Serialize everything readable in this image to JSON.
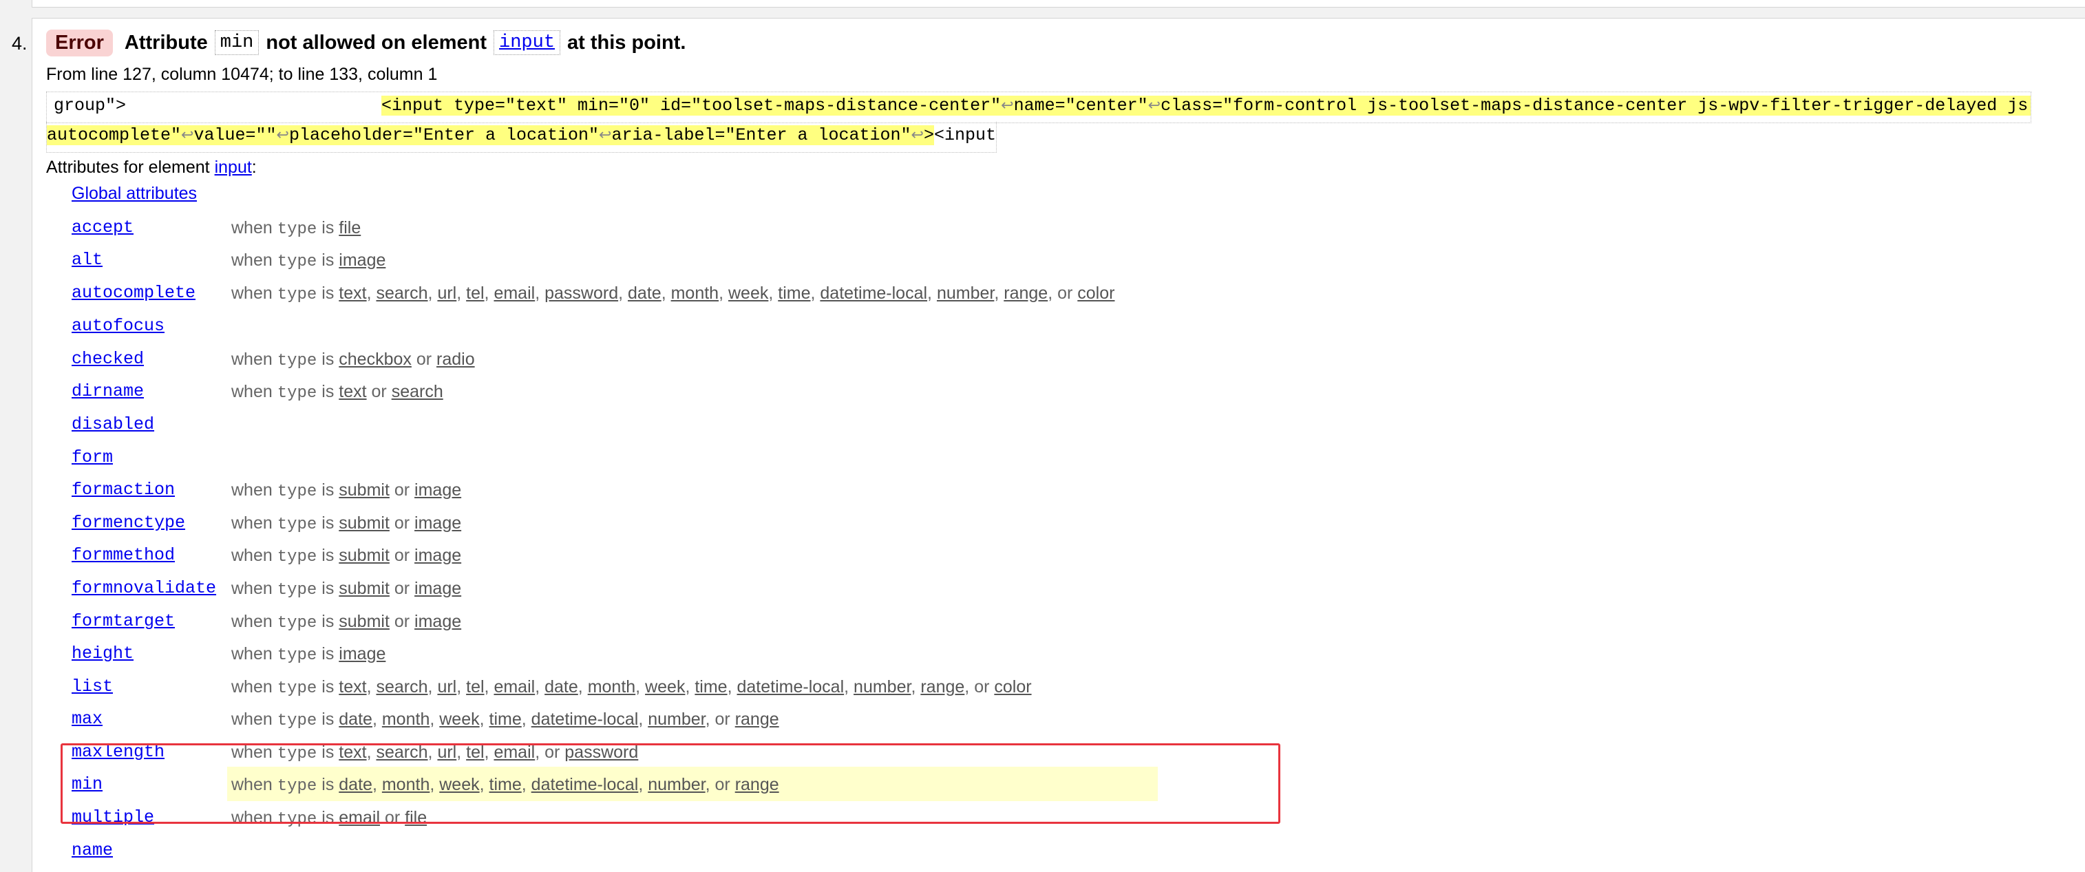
{
  "list_number": "4.",
  "error": {
    "badge": "Error",
    "word_attribute": "Attribute",
    "attribute": "min",
    "middle": "not allowed on element",
    "element": "input",
    "tail": "at this point."
  },
  "location": "From line 127, column 10474; to line 133, column 1",
  "extract": {
    "line1_plain": "group\">",
    "line1_hl": [
      "<input type=\"text\" min=\"0\" id=\"toolset-maps-distance-center\"",
      "name=\"center\"",
      "class=\"form-control js-toolset-maps-distance-center js-wpv-filter-trigger-delayed js-toolset-maps-address-"
    ],
    "line2_hl": [
      "autocomplete\"",
      "value=\"\"",
      "placeholder=\"Enter a location\"",
      "aria-label=\"Enter a location\"",
      ">"
    ],
    "line2_plain": "<input",
    "return_glyph": "↩"
  },
  "attributes_heading": {
    "prefix": "Attributes for element",
    "element": "input",
    "suffix": ":"
  },
  "global_attributes_label": "Global attributes",
  "when_type_is": "when",
  "type_kw": "type",
  "is_word": "is",
  "attributes": [
    {
      "name": "accept",
      "desc": "when type is",
      "values": [
        "file"
      ]
    },
    {
      "name": "alt",
      "desc": "when type is",
      "values": [
        "image"
      ]
    },
    {
      "name": "autocomplete",
      "desc": "when type is",
      "values": [
        "text",
        "search",
        "url",
        "tel",
        "email",
        "password",
        "date",
        "month",
        "week",
        "time",
        "datetime-local",
        "number",
        "range",
        "color"
      ]
    },
    {
      "name": "autofocus",
      "desc": "",
      "values": []
    },
    {
      "name": "checked",
      "desc": "when type is",
      "values": [
        "checkbox",
        "radio"
      ]
    },
    {
      "name": "dirname",
      "desc": "when type is",
      "values": [
        "text",
        "search"
      ]
    },
    {
      "name": "disabled",
      "desc": "",
      "values": []
    },
    {
      "name": "form",
      "desc": "",
      "values": []
    },
    {
      "name": "formaction",
      "desc": "when type is",
      "values": [
        "submit",
        "image"
      ]
    },
    {
      "name": "formenctype",
      "desc": "when type is",
      "values": [
        "submit",
        "image"
      ]
    },
    {
      "name": "formmethod",
      "desc": "when type is",
      "values": [
        "submit",
        "image"
      ]
    },
    {
      "name": "formnovalidate",
      "desc": "when type is",
      "values": [
        "submit",
        "image"
      ]
    },
    {
      "name": "formtarget",
      "desc": "when type is",
      "values": [
        "submit",
        "image"
      ]
    },
    {
      "name": "height",
      "desc": "when type is",
      "values": [
        "image"
      ]
    },
    {
      "name": "list",
      "desc": "when type is",
      "values": [
        "text",
        "search",
        "url",
        "tel",
        "email",
        "date",
        "month",
        "week",
        "time",
        "datetime-local",
        "number",
        "range",
        "color"
      ]
    },
    {
      "name": "max",
      "desc": "when type is",
      "values": [
        "date",
        "month",
        "week",
        "time",
        "datetime-local",
        "number",
        "range"
      ]
    },
    {
      "name": "maxlength",
      "desc": "when type is",
      "values": [
        "text",
        "search",
        "url",
        "tel",
        "email",
        "password"
      ]
    },
    {
      "name": "min",
      "desc": "when type is",
      "values": [
        "date",
        "month",
        "week",
        "time",
        "datetime-local",
        "number",
        "range"
      ],
      "highlighted": true
    },
    {
      "name": "multiple",
      "desc": "when type is",
      "values": [
        "email",
        "file"
      ]
    },
    {
      "name": "name",
      "desc": "",
      "values": []
    }
  ],
  "colors": {
    "link": "#0000ee",
    "error_badge_bg": "#f9d3d3",
    "extract_highlight": "#ffff80",
    "row_highlight": "#ffffcc",
    "annotation_box": "#e8343e"
  }
}
